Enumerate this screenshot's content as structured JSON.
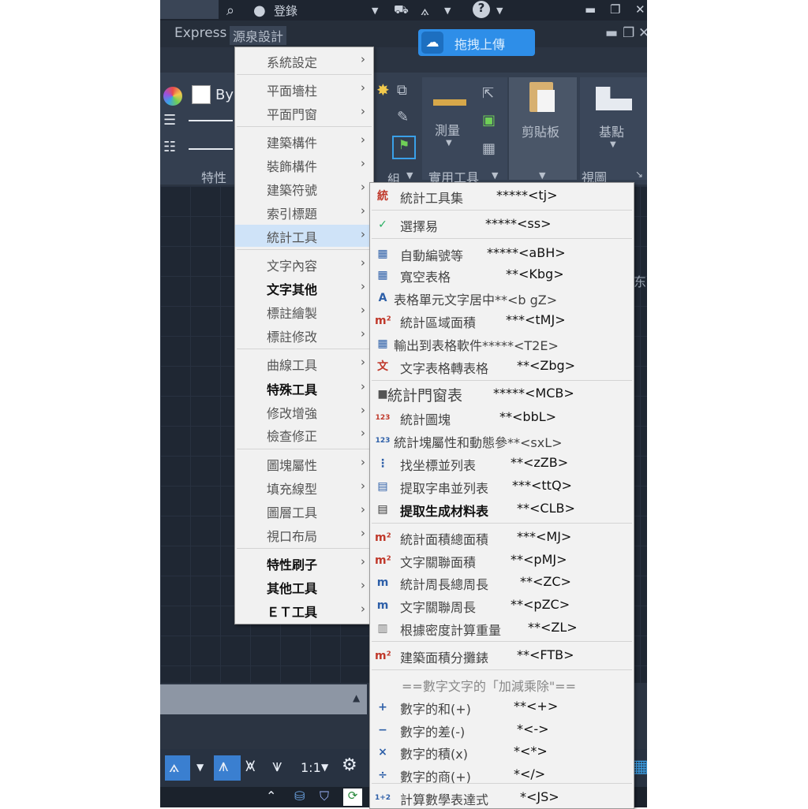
{
  "titlebar": {
    "login": "登錄"
  },
  "menubar": {
    "express": "Express",
    "yuanquan": "源泉設計"
  },
  "upload": {
    "label": "拖拽上傳"
  },
  "ribbon": {
    "byl": "ByL",
    "properties": "特性",
    "measure": "測量",
    "utilities": "實用工具",
    "clipboard": "剪貼板",
    "basepoint": "基點",
    "view": "視圖",
    "group_tail": "組"
  },
  "canvas": {
    "side_char": "东"
  },
  "statusbar": {
    "scale": "1:1"
  },
  "menu_main": {
    "items": [
      {
        "label": "系統設定",
        "bold": false
      },
      {
        "label": "平面墻柱",
        "bold": false
      },
      {
        "label": "平面門窗",
        "bold": false
      },
      {
        "label": "建築構件",
        "bold": false
      },
      {
        "label": "裝飾構件",
        "bold": false
      },
      {
        "label": "建築符號",
        "bold": false
      },
      {
        "label": "索引標題",
        "bold": false
      },
      {
        "label": "統計工具",
        "bold": false,
        "selected": true
      },
      {
        "label": "文字內容",
        "bold": false
      },
      {
        "label": "文字其他",
        "bold": true
      },
      {
        "label": "標註繪製",
        "bold": false
      },
      {
        "label": "標註修改",
        "bold": false
      },
      {
        "label": "曲線工具",
        "bold": false
      },
      {
        "label": "特殊工具",
        "bold": true
      },
      {
        "label": "修改增強",
        "bold": false
      },
      {
        "label": "檢查修正",
        "bold": false
      },
      {
        "label": "圖塊屬性",
        "bold": false
      },
      {
        "label": "填充線型",
        "bold": false
      },
      {
        "label": "圖層工具",
        "bold": false
      },
      {
        "label": "視口布局",
        "bold": false
      },
      {
        "label": "特性刷子",
        "bold": true
      },
      {
        "label": "其他工具",
        "bold": true
      },
      {
        "label": "ＥＴ工具",
        "bold": true
      }
    ]
  },
  "menu_stats": {
    "items": [
      {
        "label": "統計工具集",
        "shortcut": "*****<tj>",
        "icon": "統"
      },
      {
        "label": "選擇易",
        "shortcut": "*****<ss>",
        "icon": "✓"
      },
      {
        "label": "自動編號等",
        "shortcut": "*****<aBH>",
        "icon": "▦"
      },
      {
        "label": "寬空表格",
        "shortcut": "**<Kbg>",
        "icon": "▦"
      },
      {
        "label": "表格單元文字居中**<b gZ>",
        "shortcut": "",
        "icon": "A"
      },
      {
        "label": "統計區域面積",
        "shortcut": "***<tMJ>",
        "icon": "m²"
      },
      {
        "label": "輸出到表格軟件*****<T2E>",
        "shortcut": "",
        "icon": "▦"
      },
      {
        "label": "文字表格轉表格",
        "shortcut": "**<Zbg>",
        "icon": "文"
      },
      {
        "label": "統計門窗表",
        "shortcut": "*****<MCB>",
        "icon": "■"
      },
      {
        "label": "統計圖塊",
        "shortcut": "**<bbL>",
        "icon": "123"
      },
      {
        "label": "統計塊屬性和動態參**<sxL>",
        "shortcut": "",
        "icon": "123"
      },
      {
        "label": "找坐標並列表",
        "shortcut": "**<zZB>",
        "icon": "⋮"
      },
      {
        "label": "提取字串並列表",
        "shortcut": "***<ttQ>",
        "icon": "▤"
      },
      {
        "label": "提取生成材料表",
        "shortcut": "**<CLB>",
        "icon": "▤",
        "bold": true
      },
      {
        "label": "統計面積總面積",
        "shortcut": "***<MJ>",
        "icon": "m²"
      },
      {
        "label": "文字關聯面積",
        "shortcut": "**<pMJ>",
        "icon": "m²"
      },
      {
        "label": "統計周長總周長",
        "shortcut": "**<ZC>",
        "icon": "m"
      },
      {
        "label": "文字關聯周長",
        "shortcut": "**<pZC>",
        "icon": "m"
      },
      {
        "label": "根據密度計算重量",
        "shortcut": "**<ZL>",
        "icon": "▥"
      },
      {
        "label": "建築面積分攤錶",
        "shortcut": "**<FTB>",
        "icon": "m²"
      },
      {
        "label": "==數字文字的「加減乘除\"==",
        "shortcut": "",
        "icon": ""
      },
      {
        "label": "數字的和(+)",
        "shortcut": "**<+>",
        "icon": "+"
      },
      {
        "label": "數字的差(-)",
        "shortcut": "*<->",
        "icon": "−"
      },
      {
        "label": "數字的積(x)",
        "shortcut": "*<*>",
        "icon": "×"
      },
      {
        "label": "數字的商(+)",
        "shortcut": "*</>",
        "icon": "÷"
      },
      {
        "label": "計算數學表達式",
        "shortcut": "*<JS>",
        "icon": "1+2"
      }
    ]
  },
  "colors": {
    "accent": "#2e8ee8",
    "selection": "#cfe3f8",
    "menu_bg": "#f1f1f1"
  }
}
